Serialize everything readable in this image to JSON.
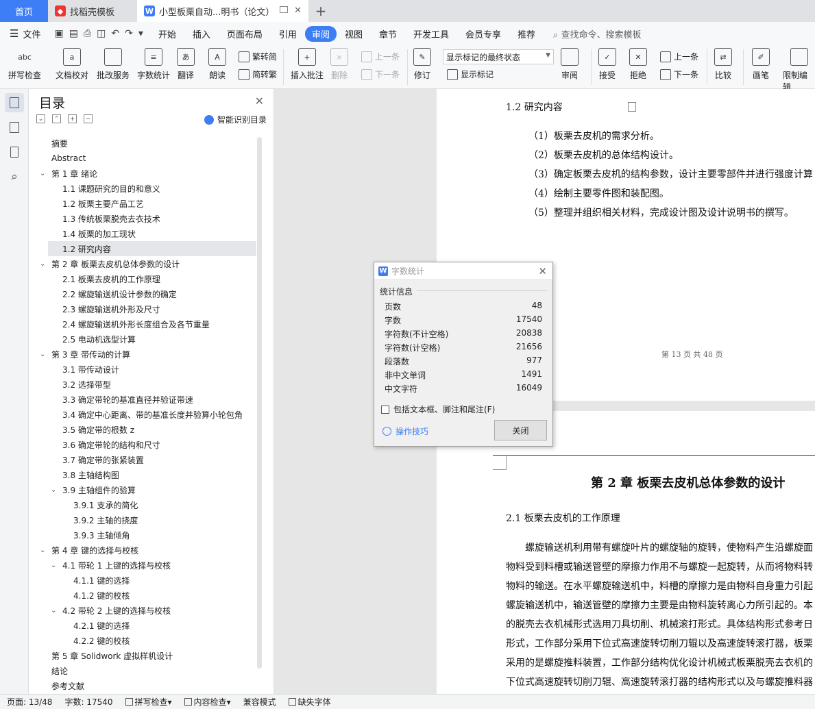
{
  "tabs": {
    "home": "首页",
    "template": "找稻壳模板",
    "doc": "小型板栗自动...明书（论文）"
  },
  "menu": {
    "file": "文件",
    "items": [
      "开始",
      "插入",
      "页面布局",
      "引用",
      "审阅",
      "视图",
      "章节",
      "开发工具",
      "会员专享",
      "推荐"
    ],
    "search": "查找命令、搜索模板"
  },
  "ribbon": {
    "spellcheck": "拼写检查",
    "proofread": "文档校对",
    "batch": "批改服务",
    "wordcount": "字数统计",
    "translate": "翻译",
    "read": "朗读",
    "to_trad": "繁转简",
    "to_simp": "简转繁",
    "insert_comment": "插入批注",
    "delete": "删除",
    "prev": "上一条",
    "next": "下一条",
    "revise": "修订",
    "markup_state": "显示标记的最终状态",
    "show_markup": "显示标记",
    "review": "审阅",
    "accept": "接受",
    "reject": "拒绝",
    "prev2": "上一条",
    "next2": "下一条",
    "compare": "比较",
    "pen": "画笔",
    "restrict": "限制编辑"
  },
  "toc": {
    "title": "目录",
    "smart": "智能识别目录",
    "items": [
      {
        "label": "摘要",
        "level": 0,
        "chev": false
      },
      {
        "label": "Abstract",
        "level": 0,
        "chev": false
      },
      {
        "label": "第 1 章  绪论",
        "level": 0,
        "chev": true
      },
      {
        "label": "1.1 课题研究的目的和意义",
        "level": 1,
        "chev": false
      },
      {
        "label": "1.2 板栗主要产品工艺",
        "level": 1,
        "chev": false
      },
      {
        "label": "1.3 传统板栗脱壳去衣技术",
        "level": 1,
        "chev": false
      },
      {
        "label": "1.4 板栗的加工现状",
        "level": 1,
        "chev": false
      },
      {
        "label": "1.2 研究内容",
        "level": 1,
        "chev": false,
        "selected": true
      },
      {
        "label": "第 2 章  板栗去皮机总体参数的设计",
        "level": 0,
        "chev": true
      },
      {
        "label": "2.1  板栗去皮机的工作原理",
        "level": 1,
        "chev": false
      },
      {
        "label": "2.2  螺旋输送机设计参数的确定",
        "level": 1,
        "chev": false
      },
      {
        "label": "2.3  螺旋输送机外形及尺寸",
        "level": 1,
        "chev": false
      },
      {
        "label": "2.4    螺旋输送机外形长度组合及各节重量",
        "level": 1,
        "chev": false
      },
      {
        "label": "2.5 电动机选型计算",
        "level": 1,
        "chev": false
      },
      {
        "label": "第 3 章  带传动的计算",
        "level": 0,
        "chev": true
      },
      {
        "label": "3.1 带传动设计",
        "level": 1,
        "chev": false
      },
      {
        "label": "3.2 选择带型",
        "level": 1,
        "chev": false
      },
      {
        "label": "3.3 确定带轮的基准直径并验证带速",
        "level": 1,
        "chev": false
      },
      {
        "label": "3.4 确定中心距离、带的基准长度并验算小轮包角",
        "level": 1,
        "chev": false
      },
      {
        "label": "3.5 确定带的根数 z",
        "level": 1,
        "chev": false
      },
      {
        "label": "3.6 确定带轮的结构和尺寸",
        "level": 1,
        "chev": false
      },
      {
        "label": "3.7 确定带的张紧装置",
        "level": 1,
        "chev": false
      },
      {
        "label": "3.8 主轴结构图",
        "level": 1,
        "chev": false
      },
      {
        "label": "3.9 主轴组件的验算",
        "level": 1,
        "chev": true
      },
      {
        "label": "3.9.1 支承的简化",
        "level": 2,
        "chev": false
      },
      {
        "label": "3.9.2 主轴的挠度",
        "level": 2,
        "chev": false
      },
      {
        "label": "3.9.3 主轴倾角",
        "level": 2,
        "chev": false
      },
      {
        "label": "第 4 章  键的选择与校核",
        "level": 0,
        "chev": true
      },
      {
        "label": "4.1 带轮 1 上键的选择与校核",
        "level": 1,
        "chev": true
      },
      {
        "label": "4.1.1 键的选择",
        "level": 2,
        "chev": false
      },
      {
        "label": "4.1.2 键的校核",
        "level": 2,
        "chev": false
      },
      {
        "label": "4.2 带轮 2 上键的选择与校核",
        "level": 1,
        "chev": true
      },
      {
        "label": "4.2.1 键的选择",
        "level": 2,
        "chev": false
      },
      {
        "label": "4.2.2 键的校核",
        "level": 2,
        "chev": false
      },
      {
        "label": "第 5 章  Solidwork 虚拟样机设计",
        "level": 0,
        "chev": false
      },
      {
        "label": "结论",
        "level": 0,
        "chev": false
      },
      {
        "label": "参考文献",
        "level": 0,
        "chev": false
      }
    ]
  },
  "doc": {
    "heading": "1.2 研究内容",
    "items": [
      "（1）板栗去皮机的需求分析。",
      "（2）板栗去皮机的总体结构设计。",
      "（3）确定板栗去皮机的结构参数，设计主要零部件并进行强度计算",
      "（4）绘制主要零件图和装配图。",
      "（5）整理并组织相关材料，完成设计图及设计说明书的撰写。"
    ],
    "page_footer": "第 13 页  共 48 页",
    "chapter_title": "第 2 章  板栗去皮机总体参数的设计",
    "section": "2.1  板栗去皮机的工作原理",
    "para": [
      "螺旋输送机利用带有螺旋叶片的螺旋轴的旋转，使物料产生沿螺旋面",
      "物料受到料槽或输送管壁的摩擦力作用不与螺旋一起旋转，从而将物料转",
      "物料的输送。在水平螺旋输送机中，料槽的摩擦力是由物料自身重力引起",
      "螺旋输送机中，输送管壁的摩擦力主要是由物料旋转离心力所引起的。本",
      "的脱壳去衣机械形式选用刀具切削、机械滚打形式。具体结构形式参考日",
      "形式，工作部分采用下位式高速旋转切削刀辊以及高速旋转滚打器，板栗",
      "采用的是螺旋推料装置，工作部分结构优化设计机械式板栗脱壳去衣机的",
      "下位式高速旋转切削刀辊、高速旋转滚打器的结构形式以及与螺旋推料器"
    ]
  },
  "dialog": {
    "title": "字数统计",
    "section": "统计信息",
    "stats": [
      {
        "label": "页数",
        "value": "48"
      },
      {
        "label": "字数",
        "value": "17540"
      },
      {
        "label": "字符数(不计空格)",
        "value": "20838"
      },
      {
        "label": "字符数(计空格)",
        "value": "21656"
      },
      {
        "label": "段落数",
        "value": "977"
      },
      {
        "label": "非中文单词",
        "value": "1491"
      },
      {
        "label": "中文字符",
        "value": "16049"
      }
    ],
    "checkbox": "包括文本框、脚注和尾注(F)",
    "tips": "操作技巧",
    "close": "关闭"
  },
  "status": {
    "page": "页面: 13/48",
    "words": "字数: 17540",
    "spell": "拼写检查",
    "content": "内容检查",
    "compat": "兼容模式",
    "font": "缺失字体"
  },
  "colors": {
    "accent": "#3d7df5",
    "tabbar": "#dfe1e5",
    "ribbon": "#f7f8fa",
    "selected_row": "#e4e6ea"
  }
}
